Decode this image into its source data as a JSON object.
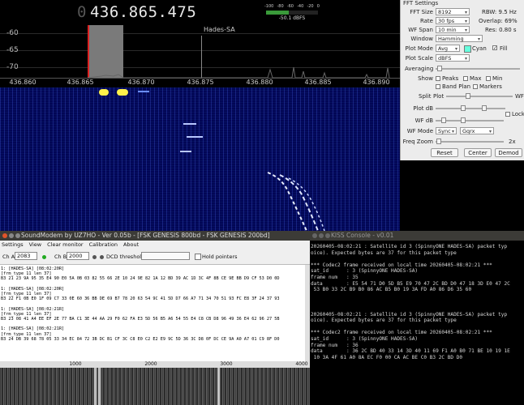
{
  "spectrum": {
    "frequency_prefix": "0",
    "frequency": "436.865.475",
    "db_labels": [
      "-60",
      "-65",
      "-70"
    ],
    "marker_label": "Hades-SA",
    "smeter_scale": [
      "-100",
      "-80",
      "-60",
      "-40",
      "-20",
      "0"
    ],
    "smeter_value": "-50.1 dBFS",
    "freq_ticks": [
      "436.860",
      "436.865",
      "436.870",
      "436.875",
      "436.880",
      "436.885",
      "436.890"
    ]
  },
  "fft": {
    "title": "FFT Settings",
    "fft_size_label": "FFT Size",
    "fft_size": "8192",
    "rbw": "RBW: 9.5 Hz",
    "rate_label": "Rate",
    "rate": "30 fps",
    "overlap": "Overlap: 69%",
    "wf_span_label": "WF Span",
    "wf_span": "10 min",
    "res": "Res: 0.80 s",
    "window_label": "Window",
    "window": "Hamming",
    "plot_mode_label": "Plot Mode",
    "plot_mode": "Avg",
    "cyan": "Cyan",
    "fill": "Fill",
    "plot_scale_label": "Plot Scale",
    "plot_scale": "dBFS",
    "averaging_label": "Averaging",
    "show_label": "Show",
    "peaks": "Peaks",
    "max": "Max",
    "min": "Min",
    "band_plan": "Band Plan",
    "markers": "Markers",
    "split_label": "Split",
    "plot": "Plot",
    "wf": "WF",
    "plot_db_label": "Plot dB",
    "wf_db_label": "WF dB",
    "lock": "Lock",
    "wf_mode_label": "WF Mode",
    "wf_mode": "Sync",
    "wf_colormap": "Gqrx",
    "freq_zoom_label": "Freq Zoom",
    "freq_zoom": "2x",
    "reset": "Reset",
    "center": "Center",
    "demod": "Demod"
  },
  "soundmodem": {
    "title": "SoundModem by UZ7HO - Ver 0.05b - [FSK GENESIS 800bd - FSK GENESIS 200bd]",
    "menu": [
      "Settings",
      "View",
      "Clear monitor",
      "Calibration",
      "About"
    ],
    "ch_a_label": "Ch A",
    "ch_a": "2083",
    "ch_b_label": "Ch B",
    "ch_b": "2000",
    "dcd_label": "DCD threshold",
    "hold_label": "Hold pointers",
    "log": "1: [HADES-SA] [08:02:20R]\n[frm_type 11 len 37]\nB3 21 23 9A 95 35 E4 90 E0 5A 0B 03 82 55 66 2E 10 24 9E 82 1A 12 BD 39 AC 1D 3C 4F 8B CE 9E BB D9 CF 53 D0 0D\n\n1: [HADES-SA] [08:02:20R]\n[frm_type 11 len 37]\nB3 22 F1 0B E0 1F 09 C7 33 0E 60 36 BB DE 69 B7 78 20 63 54 9C 41 5D D7 66 A7 71 34 70 51 93 FC E8 3F 24 37 93\n\n1: [HADES-SA] [08:02:21R]\n[frm_type 11 len 37]\nB3 23 08 41 A4 EE EF 2E 77 BA C1 3E 44 AA 29 F0 62 FA E3 5D 56 B5 A6 54 55 E4 C8 CB D8 96 49 36 E4 62 96 27 5B\n\n1: [HADES-SA] [08:02:21R]\n[frm_type 11 len 37]\nB3 24 DB 39 68 78 05 33 34 EC 84 72 3B DC B1 CF 3C C8 E0 C2 E2 E9 9C 5D 36 3C D8 0F DC CE 9A A0 A7 01 C9 8F D0",
    "ruler": [
      "1000",
      "2000",
      "3000",
      "4000"
    ]
  },
  "kiss": {
    "title": "KISS Console - v0.01",
    "console": "20260405-08:02:21 : Satellite id 3 (SpinnyONE HADES-SA) packet typ\noice). Expected bytes are 37 for this packet type\n\n*** Codec2 frame received on local time 20260405-08:02:21 ***\nsat_id      : 3 (SpinnyONE HADES-SA)\nframe num   : 35\ndata        : E5 54 71 D0 5D B5 E9 70 47 2C BD D0 47 18 3D E0 47 2C\n 53 B0 33 2C B9 B0 86 AC B5 B0 19 3A FD A0 86 D6 35 60\n\n\n\n20260405-08:02:21 : Satellite id 3 (SpinnyONE HADES-SA) packet typ\noice). Expected bytes are 37 for this packet type\n\n*** Codec2 frame received on local time 20260405-08:02:21 ***\nsat_id      : 3 (SpinnyONE HADES-SA)\nframe num   : 36\ndata        : 36 2C BD 40 33 14 3D 40 11 69 F1 A0 B0 71 BE 10 19 1E\n 10 3A 4F 61 A0 8A EC F0 00 CA AC BE C0 B3 2C BD D0"
  }
}
